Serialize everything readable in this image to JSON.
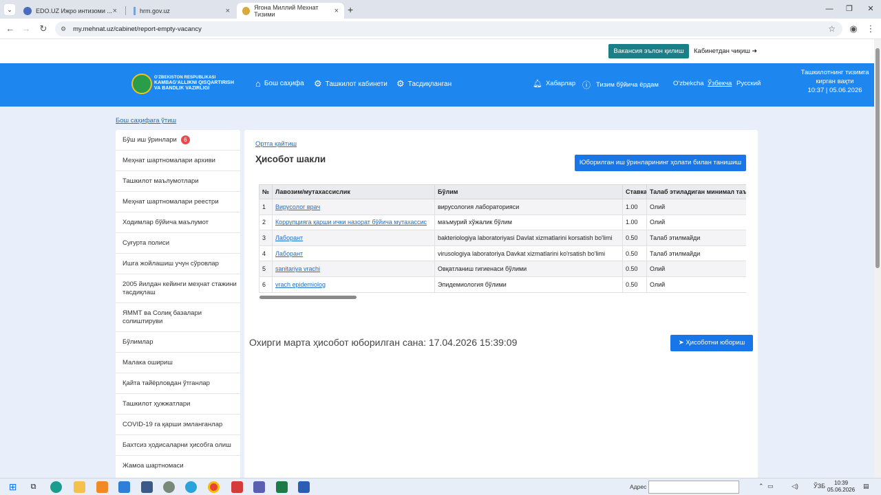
{
  "browser": {
    "tabs": [
      {
        "label": "EDO.UZ Ижро интизоми ...",
        "favicon_color": "#4b6bbf"
      },
      {
        "label": "hrm.gov.uz",
        "favicon_color": "#7aa2d9"
      },
      {
        "label": "Ягона Миллий Мехнат Тизими",
        "favicon_color": "#d8a93b"
      }
    ],
    "new_tab": "+",
    "url": "my.mehnat.uz/cabinet/report-empty-vacancy"
  },
  "topbar": {
    "vacancy_button": "Вакансия эълон қилиш",
    "logout": "Кабинетдан чиқиш"
  },
  "header": {
    "logo_line1": "O'ZBEKISTON RESPUBLIKASI",
    "logo_line2": "KAMBAG'ALLIKNI QISQARTIRISH",
    "logo_line3": "VA BANDLIK VAZIRLIGI",
    "nav": {
      "home": "Бош саҳифа",
      "cabinet": "Ташкилот кабинети",
      "approved": "Тасдиқланган"
    },
    "messages": "Хабарлар",
    "help": "Тизим бўйича ёрдам",
    "langs": [
      "O'zbekcha",
      "Ўзбекча",
      "Русский"
    ],
    "last_login_label": "Ташкилотнинг тизимга кирган вақти",
    "last_login_value": "10:37 | 05.06.2026"
  },
  "breadcrumb": "Бош саҳифага ўтиш",
  "sidebar": {
    "items": [
      {
        "label": "Бўш иш ўринлари",
        "badge": "6"
      },
      {
        "label": "Меҳнат шартномалари архиви"
      },
      {
        "label": "Ташкилот маълумотлари"
      },
      {
        "label": "Меҳнат шартномалари реестри"
      },
      {
        "label": "Ходимлар бўйича маълумот"
      },
      {
        "label": "Суғурта полиси"
      },
      {
        "label": "Ишга жойлашиш учун сўровлар"
      },
      {
        "label": "2005 йилдан кейинги меҳнат стажини тасдиқлаш"
      },
      {
        "label": "ЯММТ ва Солиқ базалари солиштируви"
      },
      {
        "label": "Бўлимлар"
      },
      {
        "label": "Малака ошириш"
      },
      {
        "label": "Қайта тайёрловдан ўтганлар"
      },
      {
        "label": "Ташкилот ҳужжатлари"
      },
      {
        "label": "COVID-19 га қарши эмланганлар"
      },
      {
        "label": "Бахтсиз ҳодисаларни ҳисобга олиш"
      },
      {
        "label": "Жамоа шартномаси"
      }
    ]
  },
  "panel": {
    "back_link": "Ортга қайтиш",
    "title": "Ҳисобот шакли",
    "view_status_button": "Юборилган иш ўринларининг ҳолати билан танишиш",
    "table": {
      "headers": [
        "№",
        "Лавозим/мутахассислик",
        "Бўлим",
        "Ставка",
        "Талаб этиладиган минимал таълим даражаси"
      ],
      "rows": [
        [
          "1",
          "Вирусолог врач",
          "вирусология лабораторияси",
          "1.00",
          "Олий"
        ],
        [
          "2",
          "Коррупцияга қарши ички назорат бўйича мутахассис",
          "маъмурий хўжалик бўлим",
          "1.00",
          "Олий"
        ],
        [
          "3",
          "Лаборант",
          "bakteriologiya laboratoriyasi Davlat xizmatlarini korsatish bo'limi",
          "0.50",
          "Талаб этилмайди"
        ],
        [
          "4",
          "Лаборант",
          "virusologiya laboratoriya Davkat xizmatlarini ko'rsatish bo'limi",
          "0.50",
          "Талаб этилмайди"
        ],
        [
          "5",
          "sanitariya vrachi",
          "Овқатланиш гигиенаси бўлими",
          "0.50",
          "Олий"
        ],
        [
          "6",
          "vrach epidemiolog",
          "Эпидемиология бўлими",
          "0.50",
          "Олий"
        ]
      ]
    },
    "last_sent": "Охирги марта ҳисобот юборилган сана: 17.04.2026 15:39:09",
    "send_button": "Ҳисоботни юбориш"
  },
  "taskbar": {
    "address_label": "Адрес",
    "lang": "ЎЗБ",
    "time": "10:39",
    "date": "05.06.2026"
  }
}
